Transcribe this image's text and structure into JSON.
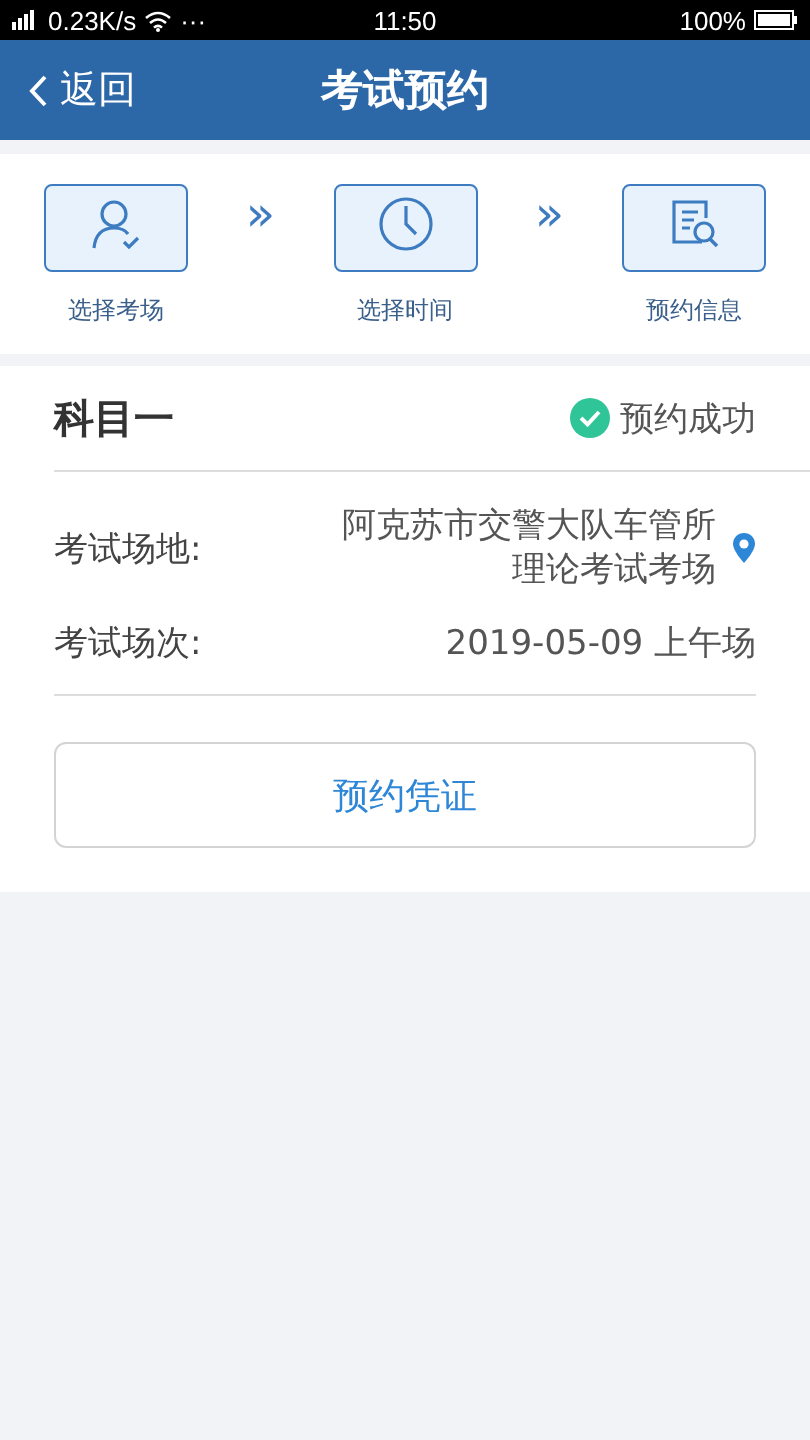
{
  "status_bar": {
    "speed": "0.23K/s",
    "more": "···",
    "time": "11:50",
    "battery": "100%"
  },
  "header": {
    "back": "返回",
    "title": "考试预约"
  },
  "steps": [
    {
      "label": "选择考场"
    },
    {
      "label": "选择时间"
    },
    {
      "label": "预约信息"
    }
  ],
  "separator": "»",
  "card": {
    "subject": "科目一",
    "status": "预约成功",
    "fields": [
      {
        "kind": "location",
        "label": "考试场地:",
        "value": "阿克苏市交警大队车管所理论考试考场"
      },
      {
        "kind": "plain",
        "label": "考试场次:",
        "value": "2019-05-09 上午场"
      }
    ],
    "button": "预约凭证"
  }
}
